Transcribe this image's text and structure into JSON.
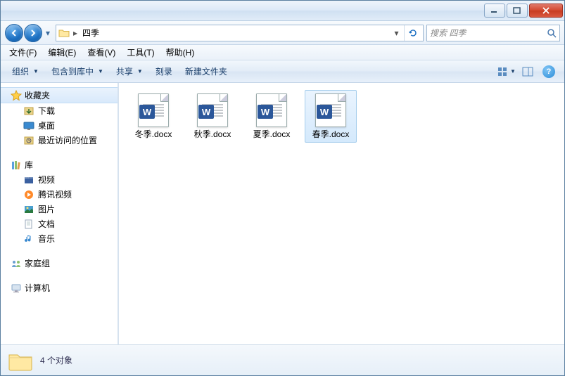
{
  "address": {
    "folder_name": "四季"
  },
  "search": {
    "placeholder": "搜索 四季"
  },
  "menubar": {
    "file": "文件(F)",
    "edit": "编辑(E)",
    "view": "查看(V)",
    "tools": "工具(T)",
    "help": "帮助(H)"
  },
  "toolbar": {
    "organize": "组织",
    "include": "包含到库中",
    "share": "共享",
    "burn": "刻录",
    "new_folder": "新建文件夹"
  },
  "sidebar": {
    "favorites": {
      "label": "收藏夹",
      "items": [
        "下载",
        "桌面",
        "最近访问的位置"
      ]
    },
    "libraries": {
      "label": "库",
      "items": [
        "视频",
        "腾讯视频",
        "图片",
        "文档",
        "音乐"
      ]
    },
    "homegroup": "家庭组",
    "computer": "计算机"
  },
  "files": [
    {
      "name": "冬季.docx",
      "selected": false
    },
    {
      "name": "秋季.docx",
      "selected": false
    },
    {
      "name": "夏季.docx",
      "selected": false
    },
    {
      "name": "春季.docx",
      "selected": true
    }
  ],
  "status": {
    "text": "4 个对象"
  }
}
